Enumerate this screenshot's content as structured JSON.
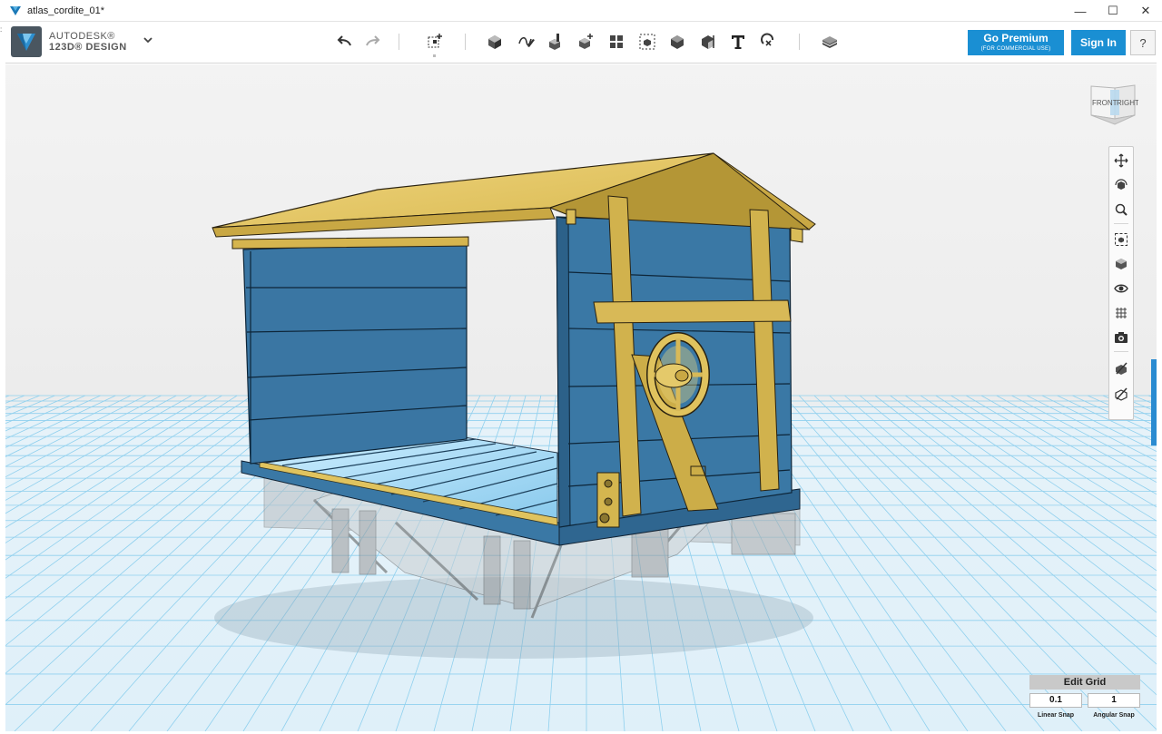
{
  "window": {
    "title": "atlas_cordite_01*",
    "controls": {
      "minimize": "—",
      "maximize": "☐",
      "close": "✕"
    }
  },
  "brand": {
    "line1": "AUTODESK®",
    "line2": "123D® DESIGN"
  },
  "toolbar": {
    "undo_icon": "undo-icon",
    "redo_icon": "redo-icon",
    "tools": [
      "transform-icon",
      "primitives-icon",
      "sketch-icon",
      "construct-icon",
      "modify-icon",
      "pattern-icon",
      "group-icon",
      "combine-icon",
      "measure-icon",
      "text-icon",
      "snap-icon",
      "material-icon"
    ],
    "premium_label": "Go Premium",
    "premium_sub": "(FOR COMMERCIAL USE)",
    "signin_label": "Sign In",
    "help_label": "?"
  },
  "viewcube": {
    "front": "FRONT",
    "right": "RIGHT"
  },
  "nav_tools": [
    "pan-icon",
    "orbit-icon",
    "zoom-icon",
    "fit-icon",
    "views-icon",
    "visibility-icon",
    "grid-icon",
    "screenshot-icon",
    "material-visibility-icon",
    "outline-icon"
  ],
  "edit_grid": {
    "title": "Edit Grid",
    "linear_snap_value": "0.1",
    "angular_snap_value": "1",
    "linear_snap_label": "Linear Snap",
    "angular_snap_label": "Angular Snap"
  },
  "colors": {
    "accent": "#1a8fd3",
    "grid_line": "#8fd0ee",
    "grid_floor": "#e2f2fa",
    "wall_blue": "#356f9a",
    "wood_gold": "#cfaf45",
    "roof_gold": "#e6c869",
    "floor_blue": "#9dd4f0"
  }
}
